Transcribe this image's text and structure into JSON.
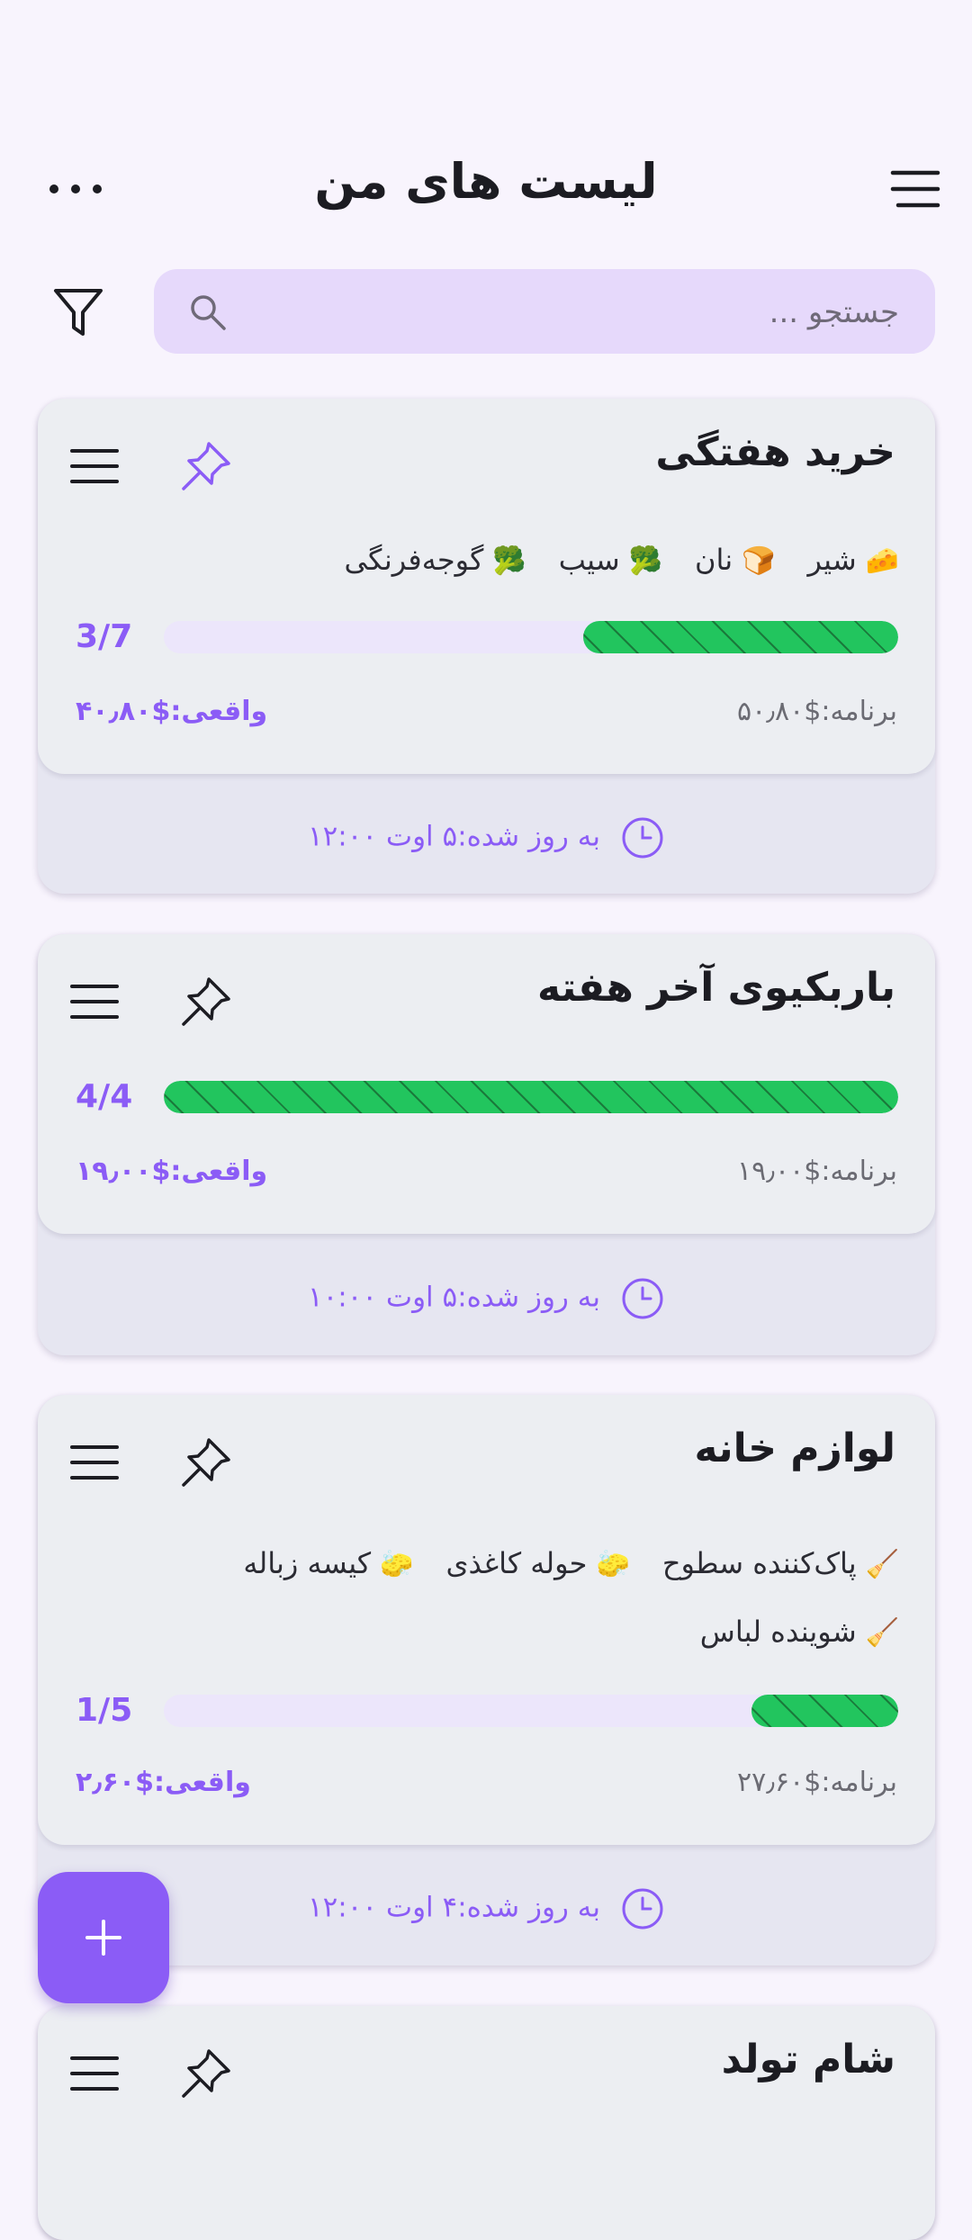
{
  "header": {
    "title": "لیست های من"
  },
  "search": {
    "placeholder": "جستجو ..."
  },
  "icons": {
    "menu": "hamburger-menu-icon",
    "more": "more-horizontal-icon",
    "filter": "filter-icon",
    "search": "search-icon",
    "pin": "pin-icon",
    "clock": "clock-icon",
    "add": "plus-icon"
  },
  "colors": {
    "accent": "#8b5cf6",
    "progress": "#22c55e",
    "search_bg": "#e6d9fb"
  },
  "lists": [
    {
      "title": "خرید هفتگی",
      "pinned": true,
      "items_rows": [
        [
          {
            "emoji": "🧀",
            "name": "شیر"
          },
          {
            "emoji": "🍞",
            "name": "نان"
          },
          {
            "emoji": "🥦",
            "name": "سیب"
          },
          {
            "emoji": "🥦",
            "name": "گوجه‌فرنگی"
          }
        ]
      ],
      "count": "3/7",
      "progress": 0.4286,
      "planned": "برنامه:$۵۰٫۸۰",
      "actual": "واقعی:$۴۰٫۸۰",
      "updated": "به روز شده:۵ اوت ۱۲:۰۰"
    },
    {
      "title": "باربکیوی آخر هفته",
      "pinned": false,
      "items_rows": [],
      "count": "4/4",
      "progress": 1.0,
      "planned": "برنامه:$۱۹٫۰۰",
      "actual": "واقعی:$۱۹٫۰۰",
      "updated": "به روز شده:۵ اوت ۱۰:۰۰"
    },
    {
      "title": "لوازم خانه",
      "pinned": false,
      "items_rows": [
        [
          {
            "emoji": "🧹",
            "name": "پاک‌کننده سطوح"
          },
          {
            "emoji": "🧽",
            "name": "حوله کاغذی"
          },
          {
            "emoji": "🧽",
            "name": "کیسه زباله"
          }
        ],
        [
          {
            "emoji": "🧹",
            "name": "شوینده لباس"
          }
        ]
      ],
      "count": "1/5",
      "progress": 0.2,
      "planned": "برنامه:$۲۷٫۶۰",
      "actual": "واقعی:$۲٫۶۰",
      "updated": "به روز شده:۴ اوت ۱۲:۰۰"
    },
    {
      "title": "شام تولد",
      "pinned": false
    }
  ]
}
